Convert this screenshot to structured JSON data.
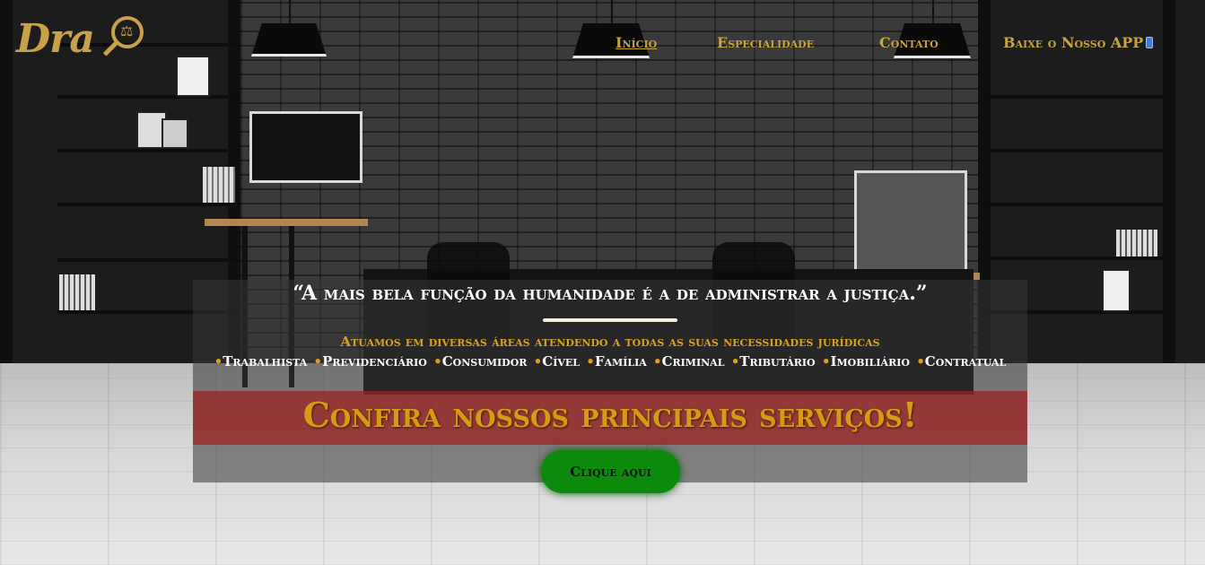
{
  "header": {
    "logo_text": "Dra",
    "logo_icon": "magnifier-scale-icon",
    "nav": [
      {
        "label": "Início",
        "active": true
      },
      {
        "label": "Especialidade",
        "active": false
      },
      {
        "label": "Contato",
        "active": false
      },
      {
        "label": "Baixe o Nosso APP",
        "active": false,
        "icon": "phone-icon"
      }
    ]
  },
  "hero": {
    "quote": "“A mais bela função da humanidade é a de administrar a justiça.”",
    "areas_title": "Atuamos em diversas áreas atendendo a todas as suas necessidades jurídicas",
    "areas": [
      "Trabalhista",
      "Previdenciário",
      "Consumidor",
      "Cível",
      "Família",
      "Criminal",
      "Tributário",
      "Imobiliário",
      "Contratual"
    ],
    "banner": "Confira nossos principais serviços!",
    "cta_label": "Clique aqui"
  },
  "colors": {
    "gold": "#c8a43a",
    "banner_red": "#a01e1e",
    "cta_green": "#0b8a0b"
  }
}
